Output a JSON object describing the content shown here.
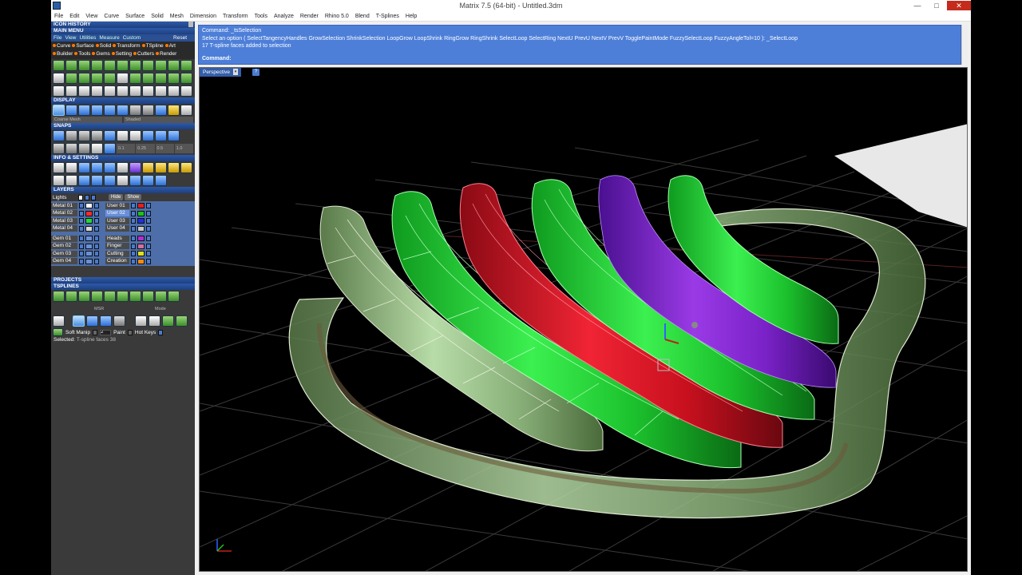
{
  "window": {
    "title": "Matrix 7.5 (64-bit) - Untitled.3dm",
    "min": "—",
    "max": "□",
    "close": "✕"
  },
  "menu": [
    "File",
    "Edit",
    "View",
    "Curve",
    "Surface",
    "Solid",
    "Mesh",
    "Dimension",
    "Transform",
    "Tools",
    "Analyze",
    "Render",
    "Rhino 5.0",
    "Blend",
    "T-Splines",
    "Help"
  ],
  "panel": {
    "icon_history": "ICON HISTORY",
    "main_menu": "MAIN MENU",
    "tabs": [
      "File",
      "View",
      "Utilities",
      "Measure",
      "Custom"
    ],
    "reset": "Reset",
    "chips_row1": [
      "Curve",
      "Surface",
      "Solid",
      "Transform",
      "TSpline",
      "Art"
    ],
    "chips_row2": [
      "Builder",
      "Tools",
      "Gems",
      "Setting",
      "Cutters",
      "Render"
    ],
    "display": "DISPLAY",
    "display_drop1": "Coarse Mesh",
    "display_drop2": "Shaded",
    "snaps": "SNAPS",
    "snap_values": [
      "0.1",
      "0.25",
      "0.5",
      "1.0"
    ],
    "info_settings": "INFO & SETTINGS",
    "layers": "LAYERS",
    "lights": "Lights",
    "hide": "Hide",
    "show": "Show",
    "metal_layers": [
      "Metal 01",
      "Metal 02",
      "Metal 03",
      "Metal 04"
    ],
    "user_layers": [
      "User 01",
      "User 02",
      "User 03",
      "User 04"
    ],
    "gem_layers": [
      "Gem 01",
      "Gem 02",
      "Gem 03",
      "Gem 04"
    ],
    "part_layers": [
      "Heads",
      "Finger",
      "Cutting",
      "Creation"
    ],
    "projects": "PROJECTS",
    "tsplines": "TSPLINES",
    "msr": "MSR",
    "mode": "Mode",
    "soft_manip": "Soft Manip",
    "soft_value": "2",
    "paint": "Paint",
    "hot_keys": "Hot Keys",
    "selected_label": "Selected:",
    "selected_value": "T-spline faces 38"
  },
  "command": {
    "line1": "Command: _tsSelection",
    "line2": "Select an option ( SelectTangencyHandles  GrowSelection  ShrinkSelection  LoopGrow  LoopShrink  RingGrow  RingShrink  SelectLoop  SelectRing  NextU  PrevU  NextV  PrevV  TogglePaintMode  FuzzySelectLoop  FuzzyAngleTol=10 ): _SelectLoop",
    "line3": "17 T-spline faces added to selection",
    "prompt": "Command:"
  },
  "viewport": {
    "name": "Perspective",
    "dropdown_arrow": "▾",
    "help": "?"
  },
  "colors": {
    "cmd_bg": "#4d7fd9",
    "viewport_bg": "#000000",
    "green": "#22e03a",
    "red": "#e0142a",
    "purple": "#8a2ad6",
    "pale_green": "#9ac78a",
    "metal_swatches": [
      "#ffffff",
      "#ff2a2a",
      "#22d93a",
      "#d8d8d8"
    ],
    "user_swatches": [
      "#e02020",
      "#20c020",
      "#2030e0",
      "#c8c8c8"
    ],
    "part_swatches": [
      "#b030d0",
      "#d070a0",
      "#e0e020",
      "#ff8a10"
    ]
  }
}
